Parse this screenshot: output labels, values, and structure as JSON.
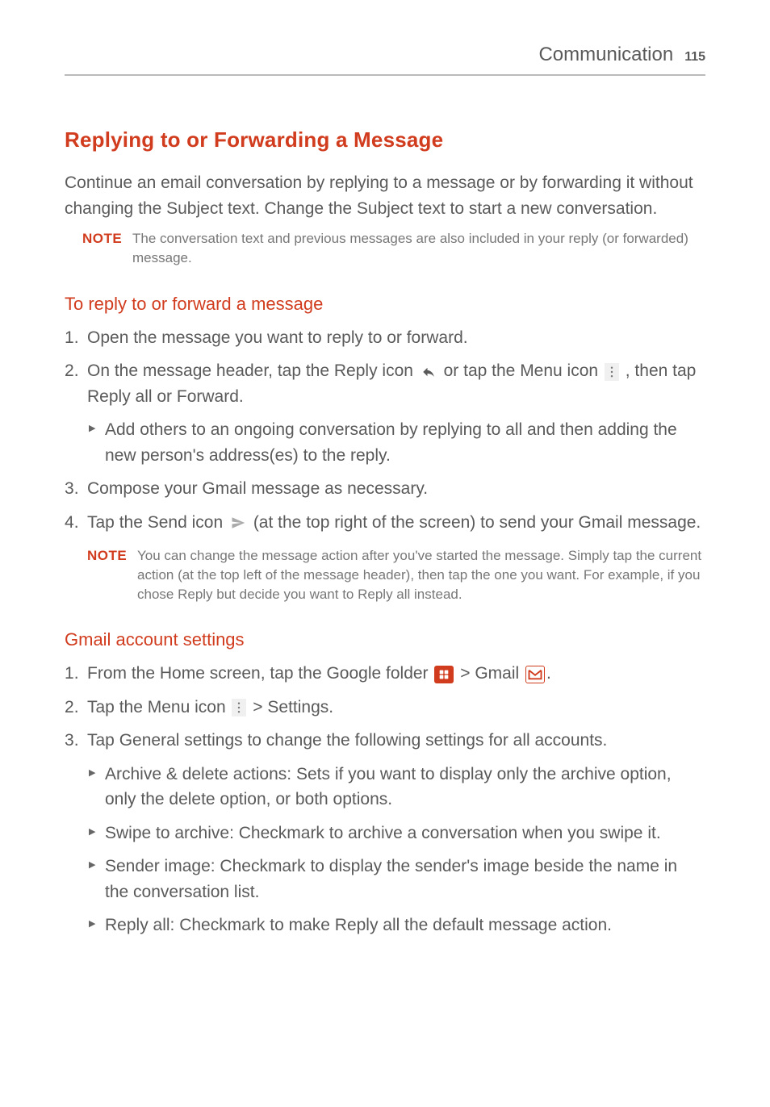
{
  "header": {
    "section": "Communication",
    "page": "115"
  },
  "h1": "Replying to or Forwarding a Message",
  "intro": "Continue an email conversation by replying to a message or by forwarding it without changing the Subject text. Change the Subject text to start a new conversation.",
  "note1": {
    "label": "NOTE",
    "text": "The conversation text and previous messages are also included in your reply (or forwarded) message."
  },
  "h2a": "To reply to or forward a message",
  "s1": "Open the message you want to reply to or forward.",
  "s2a": "On the message header, tap the ",
  "s2_reply": "Reply",
  "s2b": " icon ",
  "s2c": " or tap the ",
  "s2_menu": "Menu",
  "s2d": " icon ",
  "s2e": " , then tap ",
  "s2_replyall": "Reply all",
  "s2f": " or ",
  "s2_forward": "Forward",
  "s2g": ".",
  "s2_sub": "Add others to an ongoing conversation by replying to all and then adding the new person's address(es) to the reply.",
  "s3": "Compose your Gmail message as necessary.",
  "s4a": "Tap the ",
  "s4_send": "Send",
  "s4b": " icon ",
  "s4c": " (at the top right of the screen) to send your Gmail message.",
  "note2": {
    "label": "NOTE",
    "text": "You can change the message action after you've started the message. Simply tap the current action (at the top left of the message header), then tap the one you want. For example, if you chose Reply but decide you want to Reply all instead."
  },
  "h2b": "Gmail account settings",
  "g1a": "From the Home screen, tap the ",
  "g1_google": "Google",
  "g1b": " folder ",
  "g1_gt1": " > ",
  "g1_gmail": "Gmail",
  "g1c": " ",
  "g1d": ".",
  "g2a": "Tap the ",
  "g2_menu": "Menu",
  "g2b": " icon ",
  "g2_gt": " > ",
  "g2_settings": "Settings",
  "g2c": ".",
  "g3a": "Tap ",
  "g3_gs": "General settings",
  "g3b": " to change the following settings for all accounts.",
  "g3s1_b": "Archive & delete actions",
  "g3s1_t": ": Sets if you want to display only the archive option, only the delete option, or both options.",
  "g3s2_b": "Swipe to archive",
  "g3s2_t": ": Checkmark to archive a conversation when you swipe it.",
  "g3s3_b": "Sender image",
  "g3s3_t": ": Checkmark to display the sender's image beside the name in the conversation list.",
  "g3s4_b": "Reply all",
  "g3s4_t": ": Checkmark to make Reply all the default message action."
}
